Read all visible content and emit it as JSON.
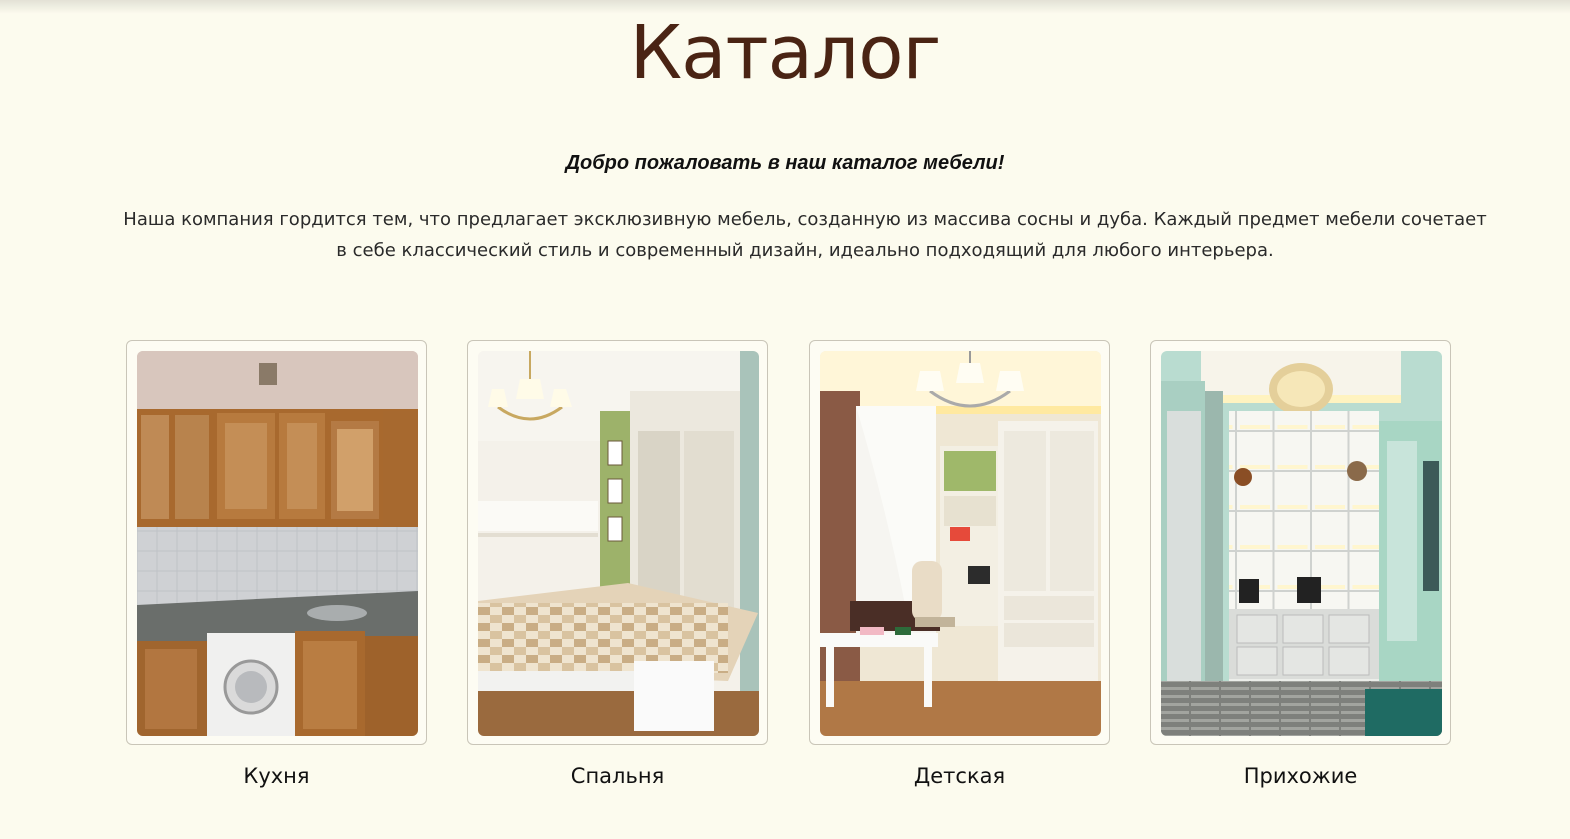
{
  "page": {
    "title": "Каталог",
    "welcome": "Добро пожаловать в наш каталог мебели!",
    "intro": "Наша компания гордится тем, что предлагает эксклюзивную мебель, созданную из массива сосны и дуба. Каждый предмет мебели сочетает в себе классический стиль и современный дизайн, идеально подходящий для любого интерьера."
  },
  "categories": [
    {
      "label": "Кухня",
      "image": "kitchen-photo"
    },
    {
      "label": "Спальня",
      "image": "bedroom-photo"
    },
    {
      "label": "Детская",
      "image": "kids-room-photo"
    },
    {
      "label": "Прихожие",
      "image": "hallway-photo"
    }
  ],
  "colors": {
    "background": "#fcfbee",
    "title": "#4a2414",
    "card_border": "#c9c5b8"
  }
}
